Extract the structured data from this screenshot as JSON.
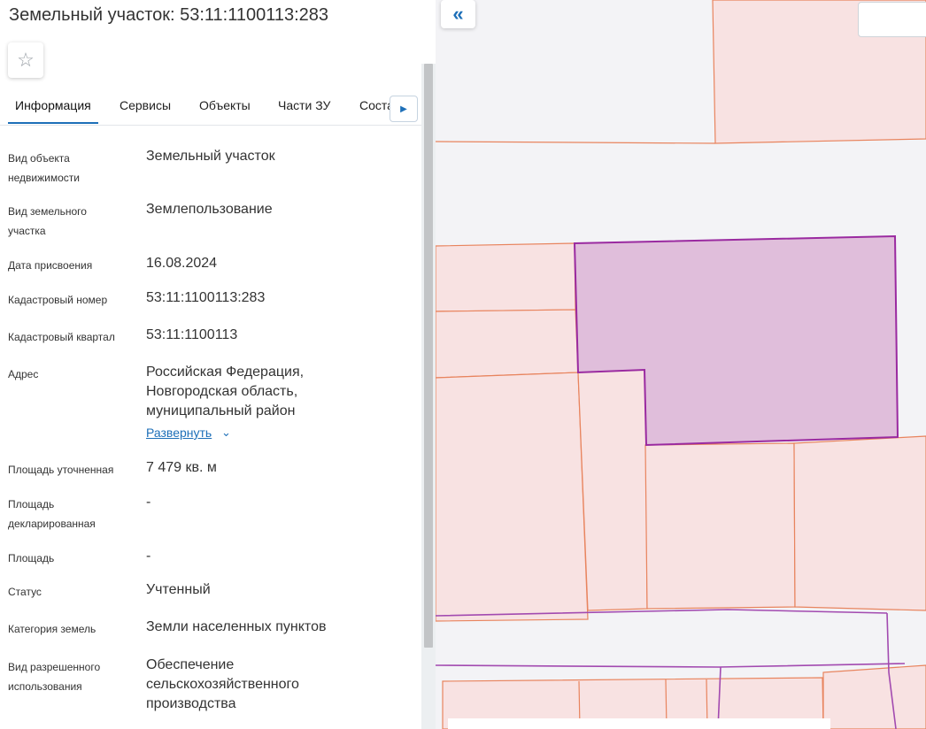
{
  "header": {
    "title": "Земельный участок: 53:11:1100113:283"
  },
  "favorite": {
    "icon": "star-outline-icon"
  },
  "tabs": [
    {
      "label": "Информация",
      "active": true
    },
    {
      "label": "Сервисы"
    },
    {
      "label": "Объекты"
    },
    {
      "label": "Части ЗУ"
    },
    {
      "label": "Соста"
    }
  ],
  "tabs_next_icon": "caret-right-icon",
  "info": {
    "object_type": {
      "label": "Вид объекта недвижимости",
      "value": "Земельный участок"
    },
    "land_type": {
      "label": "Вид земельного участка",
      "value": "Землепользование"
    },
    "assign_date": {
      "label": "Дата присвоения",
      "value": "16.08.2024"
    },
    "cadastral_number": {
      "label": "Кадастровый номер",
      "value": "53:11:1100113:283"
    },
    "cadastral_block": {
      "label": "Кадастровый квартал",
      "value": "53:11:1100113"
    },
    "address": {
      "label": "Адрес",
      "lines": [
        "Российская Федерация,",
        "Новгородская область,",
        "муниципальный район"
      ],
      "expand_label": "Развернуть"
    },
    "area_precise": {
      "label": "Площадь уточненная",
      "value": "7 479 кв. м"
    },
    "area_declared": {
      "label": "Площадь декларированная",
      "value": "-"
    },
    "area": {
      "label": "Площадь",
      "value": "-"
    },
    "status": {
      "label": "Статус",
      "value": "Учтенный"
    },
    "land_category": {
      "label": "Категория земель",
      "value": "Земли населенных пунктов"
    },
    "permitted_use": {
      "label": "Вид разрешенного использования",
      "lines": [
        "Обеспечение",
        "сельскохозяйственного",
        "производства"
      ]
    }
  },
  "map": {
    "collapse_icon": "double-chevron-left-icon",
    "colors": {
      "background": "#f3f3f6",
      "parcel_fill": "#f8e2e2",
      "parcel_stroke": "#e8845e",
      "selected_fill": "#e0bedb",
      "selected_stroke": "#9a2aa0"
    }
  }
}
